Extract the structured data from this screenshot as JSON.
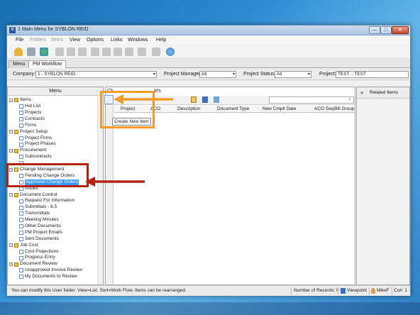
{
  "window": {
    "title": "1 Main Menu for SYBLON REID",
    "app_icon": "V",
    "minimize": "—",
    "maximize": "□",
    "close": "✕"
  },
  "menubar": [
    "File",
    "Folders",
    "Items",
    "View",
    "Options",
    "Links",
    "Windows",
    "Help"
  ],
  "tabs": [
    "Menu",
    "PM Workflow"
  ],
  "filters": {
    "company_label": "Company:",
    "company_value": "1 - SYBLON REID",
    "pm_label": "Project Manager:",
    "pm_value": "All",
    "status_label": "Project Status:",
    "status_value": "All",
    "project_label": "Project:",
    "project_value": "TEST. - TEST"
  },
  "menu_panel": {
    "header": "Menu",
    "tree": [
      {
        "label": "Items",
        "type": "folder",
        "level": 0,
        "expander": "−"
      },
      {
        "label": "Hot List",
        "type": "doc",
        "level": 1
      },
      {
        "label": "Projects",
        "type": "doc",
        "level": 1
      },
      {
        "label": "Contracts",
        "type": "doc",
        "level": 1
      },
      {
        "label": "Firms",
        "type": "doc",
        "level": 1
      },
      {
        "label": "Project Setup",
        "type": "folder",
        "level": 0,
        "expander": "−"
      },
      {
        "label": "Project Firms",
        "type": "doc",
        "level": 1
      },
      {
        "label": "Project Phases",
        "type": "doc",
        "level": 1
      },
      {
        "label": "Procurement",
        "type": "folder",
        "level": 0,
        "expander": "−"
      },
      {
        "label": "Subcontracts",
        "type": "doc",
        "level": 1
      },
      {
        "label": "",
        "type": "doc",
        "level": 1
      },
      {
        "label": "Change Management",
        "type": "folder",
        "level": 0,
        "expander": "−"
      },
      {
        "label": "Pending Change Orders",
        "type": "doc",
        "level": 1
      },
      {
        "label": "Approved Change Orders",
        "type": "doc",
        "level": 1,
        "selected": true
      },
      {
        "label": "Issues",
        "type": "doc",
        "level": 1
      },
      {
        "label": "Document Control",
        "type": "folder",
        "level": 0,
        "expander": "−"
      },
      {
        "label": "Request For Information",
        "type": "doc",
        "level": 1
      },
      {
        "label": "Submittals - 6.5",
        "type": "doc",
        "level": 1
      },
      {
        "label": "Transmittals",
        "type": "doc",
        "level": 1
      },
      {
        "label": "Meeting Minutes",
        "type": "doc",
        "level": 1
      },
      {
        "label": "Other Documents",
        "type": "doc",
        "level": 1
      },
      {
        "label": "PM Project Emails",
        "type": "doc",
        "level": 1
      },
      {
        "label": "Sent Documents",
        "type": "doc",
        "level": 1
      },
      {
        "label": "Job Cost",
        "type": "folder",
        "level": 0,
        "expander": "−"
      },
      {
        "label": "Cost Projections",
        "type": "doc",
        "level": 1
      },
      {
        "label": "Progress Entry",
        "type": "doc",
        "level": 1
      },
      {
        "label": "Document Review",
        "type": "folder",
        "level": 0,
        "expander": "−"
      },
      {
        "label": "Unapproved Invoice Review",
        "type": "doc",
        "level": 1
      },
      {
        "label": "My Documents to Review",
        "type": "doc",
        "level": 1
      }
    ]
  },
  "grid": {
    "header_partial": "Ch",
    "header_partial2": "ers",
    "columns": [
      "Project",
      "ACO",
      "Description",
      "Document Type",
      "New Cmplt Date",
      "ACO Seq",
      "Bill Group"
    ],
    "tooltip": "Create New Item"
  },
  "related": {
    "toggle": "»",
    "title": "Related Items"
  },
  "statusbar": {
    "message": "You can modify this User folder. View=List. Sort=Work Flow. Items can be rearranged.",
    "records": "Number of Records: 0",
    "viewpoint": "Viewpoint",
    "user": "MikeF",
    "company": "Co#: 1"
  },
  "colors": {
    "highlight_orange": "#f29a2a",
    "highlight_red": "#b52212",
    "selection_blue": "#3399ff"
  }
}
